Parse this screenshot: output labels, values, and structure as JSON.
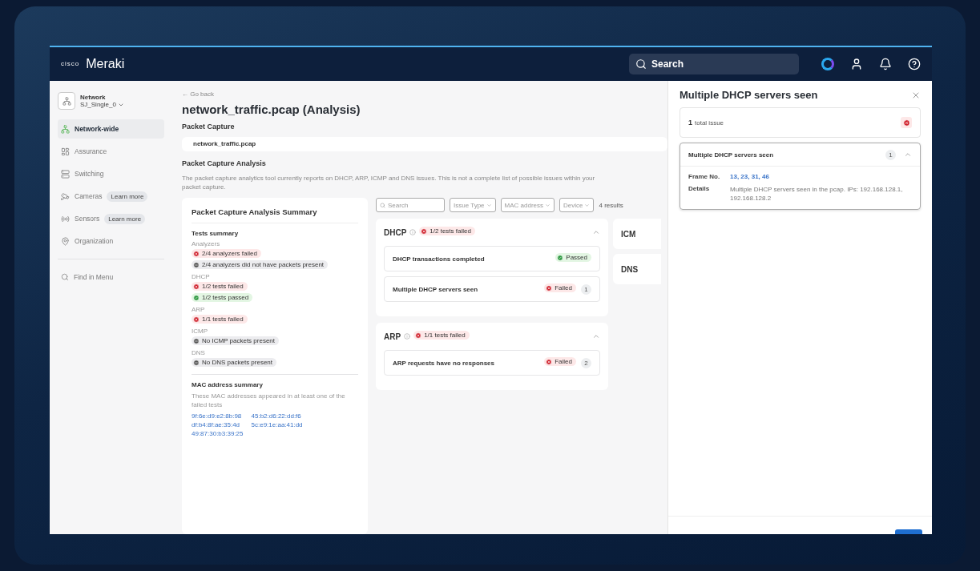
{
  "header": {
    "brand_mark": "cisco",
    "brand": "Meraki",
    "search_placeholder": "Search"
  },
  "sidebar": {
    "network_label": "Network",
    "network_name": "SJ_Single_0",
    "items": [
      {
        "label": "Network-wide",
        "selected": true
      },
      {
        "label": "Assurance",
        "selected": false
      },
      {
        "label": "Switching",
        "selected": false
      },
      {
        "label": "Cameras",
        "selected": false,
        "badge": "Learn more"
      },
      {
        "label": "Sensors",
        "selected": false,
        "badge": "Learn more"
      },
      {
        "label": "Organization",
        "selected": false
      }
    ],
    "find": "Find in Menu"
  },
  "main": {
    "back": "← Go back",
    "title": "network_traffic.pcap (Analysis)",
    "capture_heading": "Packet Capture",
    "capture_file": "network_traffic.pcap",
    "analysis_heading": "Packet Capture Analysis",
    "analysis_text": "The packet capture analytics tool currently reports on DHCP, ARP, ICMP and DNS issues. This is not a complete list of possible issues within your packet capture.",
    "summary": {
      "title": "Packet Capture Analysis Summary",
      "tests_heading": "Tests summary",
      "groups": [
        {
          "label": "Analyzers",
          "tags": [
            {
              "text": "2/4 analyzers failed",
              "kind": "failed"
            },
            {
              "text": "2/4 analyzers did not have packets present",
              "kind": "none"
            }
          ]
        },
        {
          "label": "DHCP",
          "tags": [
            {
              "text": "1/2 tests failed",
              "kind": "failed"
            },
            {
              "text": "1/2 tests passed",
              "kind": "passed"
            }
          ]
        },
        {
          "label": "ARP",
          "tags": [
            {
              "text": "1/1 tests failed",
              "kind": "failed"
            }
          ]
        },
        {
          "label": "ICMP",
          "tags": [
            {
              "text": "No ICMP packets present",
              "kind": "none"
            }
          ]
        },
        {
          "label": "DNS",
          "tags": [
            {
              "text": "No DNS packets present",
              "kind": "none"
            }
          ]
        }
      ],
      "mac_heading": "MAC address summary",
      "mac_text": "These MAC addresses appeared in at least one of the failed tests",
      "macs": [
        "9f:6e:d9:e2:8b:98",
        "45:b2:d6:22:dd:f6",
        "df:b4:8f:ae:35:4d",
        "5c:e9:1e:aa:41:dd",
        "49:87:30:b3:39:25"
      ]
    },
    "filters": {
      "search_placeholder": "Search",
      "dropdowns": [
        "Issue Type",
        "MAC address",
        "Device"
      ],
      "results": "4 results"
    },
    "sections": [
      {
        "name": "DHCP",
        "tag": {
          "text": "1/2 tests failed",
          "kind": "failed"
        },
        "expanded": true,
        "tests": [
          {
            "name": "DHCP transactions completed",
            "status": {
              "text": "Passed",
              "kind": "passed"
            }
          },
          {
            "name": "Multiple DHCP servers seen",
            "status": {
              "text": "Failed",
              "kind": "failed"
            },
            "count": "1"
          }
        ]
      },
      {
        "name": "ARP",
        "tag": {
          "text": "1/1 tests failed",
          "kind": "failed"
        },
        "expanded": true,
        "tests": [
          {
            "name": "ARP requests have no responses",
            "status": {
              "text": "Failed",
              "kind": "failed"
            },
            "count": "2"
          }
        ]
      }
    ],
    "side_sections": [
      "ICM",
      "DNS"
    ]
  },
  "drawer": {
    "title": "Multiple DHCP servers seen",
    "total_count": "1",
    "total_label": "total issue",
    "issue": {
      "name": "Multiple DHCP servers seen",
      "count": "1",
      "expanded": true,
      "frame_label": "Frame No.",
      "frames": "13, 23, 31, 46",
      "details_label": "Details",
      "details": "Multiple DHCP servers seen in the pcap. IPs: 192.168.128.1, 192.168.128.2"
    }
  }
}
